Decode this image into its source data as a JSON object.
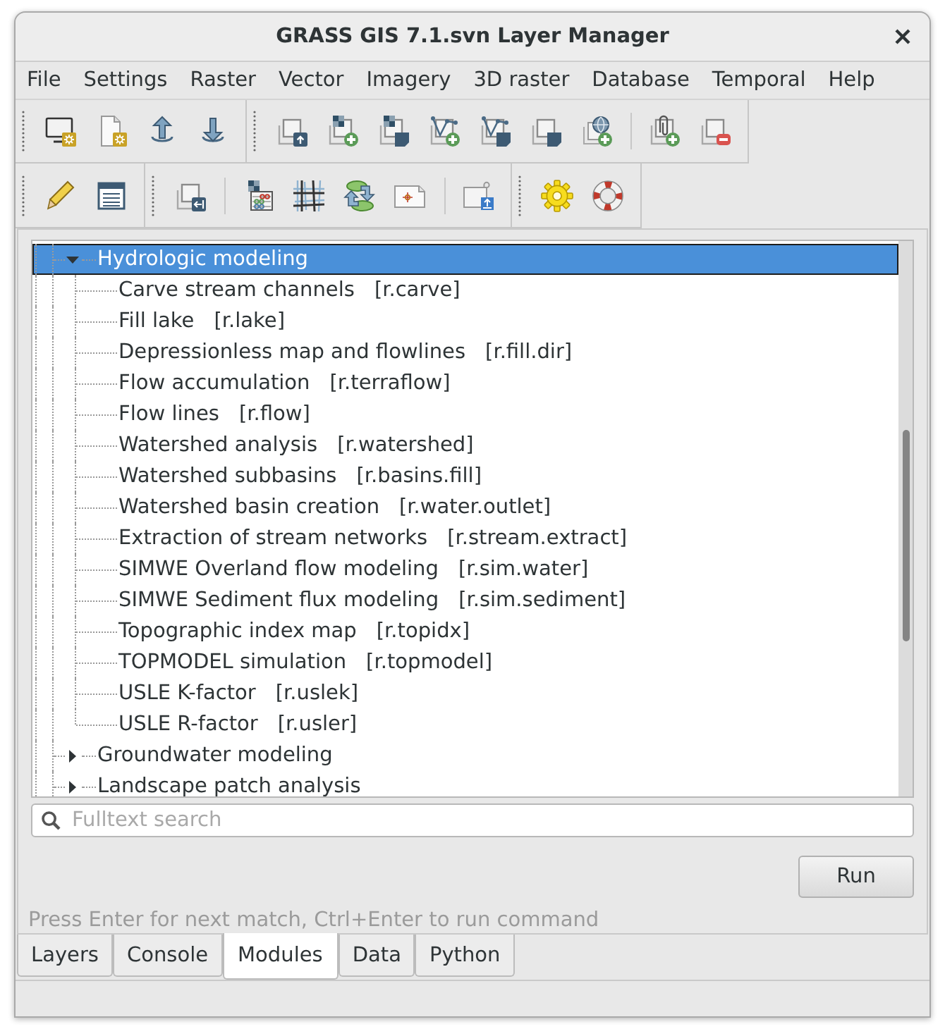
{
  "window": {
    "title": "GRASS GIS 7.1.svn Layer Manager"
  },
  "menu": [
    "File",
    "Settings",
    "Raster",
    "Vector",
    "Imagery",
    "3D raster",
    "Database",
    "Temporal",
    "Help"
  ],
  "module_tree": {
    "items": [
      {
        "label": "Hydrologic modeling",
        "expanded": true,
        "selected": true,
        "children": [
          {
            "label": "Carve stream channels",
            "command": "[r.carve]",
            "selected": false
          },
          {
            "label": "Fill lake",
            "command": "[r.lake]",
            "selected": false
          },
          {
            "label": "Depressionless map and flowlines",
            "command": "[r.fill.dir]",
            "selected": false
          },
          {
            "label": "Flow accumulation",
            "command": "[r.terraflow]",
            "selected": false
          },
          {
            "label": "Flow lines",
            "command": "[r.flow]",
            "selected": false
          },
          {
            "label": "Watershed analysis",
            "command": "[r.watershed]",
            "selected": false
          },
          {
            "label": "Watershed subbasins",
            "command": "[r.basins.fill]",
            "selected": false
          },
          {
            "label": "Watershed basin creation",
            "command": "[r.water.outlet]",
            "selected": false
          },
          {
            "label": "Extraction of stream networks",
            "command": "[r.stream.extract]",
            "selected": false
          },
          {
            "label": "SIMWE Overland flow modeling",
            "command": "[r.sim.water]",
            "selected": false
          },
          {
            "label": "SIMWE Sediment flux modeling",
            "command": "[r.sim.sediment]",
            "selected": false
          },
          {
            "label": "Topographic index map",
            "command": "[r.topidx]",
            "selected": false
          },
          {
            "label": "TOPMODEL simulation",
            "command": "[r.topmodel]",
            "selected": false
          },
          {
            "label": "USLE K-factor",
            "command": "[r.uslek]",
            "selected": false
          },
          {
            "label": "USLE R-factor",
            "command": "[r.usler]",
            "selected": false
          }
        ]
      },
      {
        "label": "Groundwater modeling",
        "expanded": false,
        "selected": false
      },
      {
        "label": "Landscape patch analysis",
        "expanded": false,
        "selected": false
      }
    ]
  },
  "search": {
    "placeholder": "Fulltext search"
  },
  "run_button": "Run",
  "hint": "Press Enter for next match, Ctrl+Enter to run command",
  "tabs": [
    {
      "label": "Layers",
      "selected": false
    },
    {
      "label": "Console",
      "selected": false
    },
    {
      "label": "Modules",
      "selected": true
    },
    {
      "label": "Data",
      "selected": false
    },
    {
      "label": "Python",
      "selected": false
    }
  ]
}
